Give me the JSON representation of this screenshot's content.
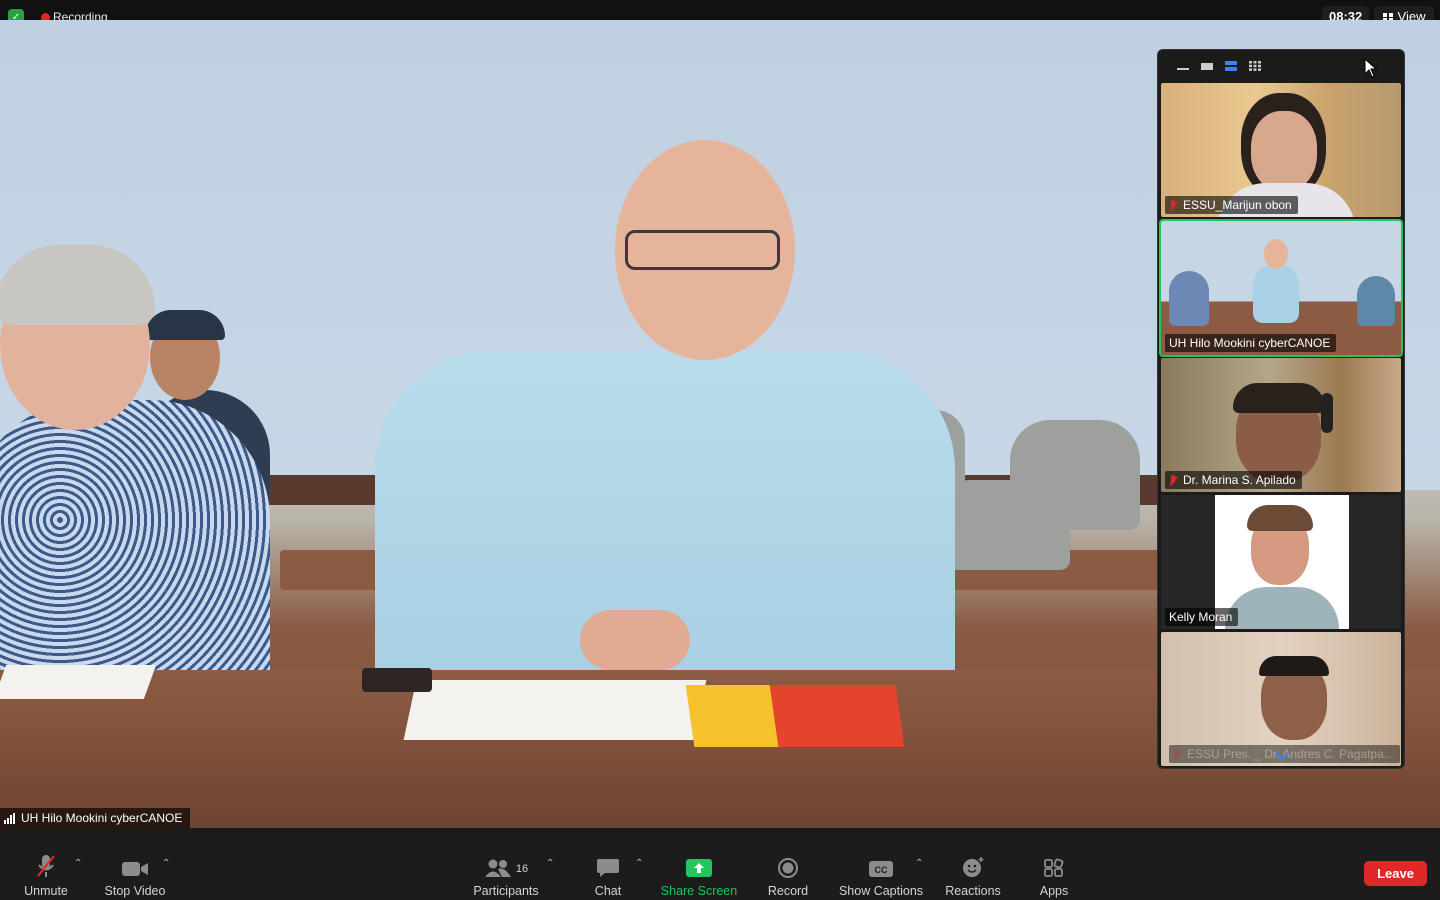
{
  "top": {
    "recording_label": "Recording",
    "clock": "08:32",
    "view_label": "View"
  },
  "main_video": {
    "participant_label": "UH Hilo Mookini cyberCANOE"
  },
  "gallery": {
    "tiles": [
      {
        "name": "ESSU_Marijun obon",
        "muted": true,
        "active": false
      },
      {
        "name": "UH Hilo Mookini cyberCANOE",
        "muted": false,
        "active": true
      },
      {
        "name": "Dr. Marina S. Apilado",
        "muted": true,
        "active": false
      },
      {
        "name": "Kelly Moran",
        "muted": false,
        "active": false
      },
      {
        "name": "ESSU Pres. _ Dr. Andres C. Pagatpa...",
        "muted": true,
        "active": false
      }
    ]
  },
  "toolbar": {
    "unmute": "Unmute",
    "stop_video": "Stop Video",
    "participants": "Participants",
    "participants_count": "16",
    "chat": "Chat",
    "share_screen": "Share Screen",
    "record": "Record",
    "show_captions": "Show Captions",
    "reactions": "Reactions",
    "apps": "Apps",
    "leave": "Leave"
  },
  "colors": {
    "accent_green": "#22c55e",
    "leave_red": "#e02828",
    "recording_red": "#e0262b"
  }
}
